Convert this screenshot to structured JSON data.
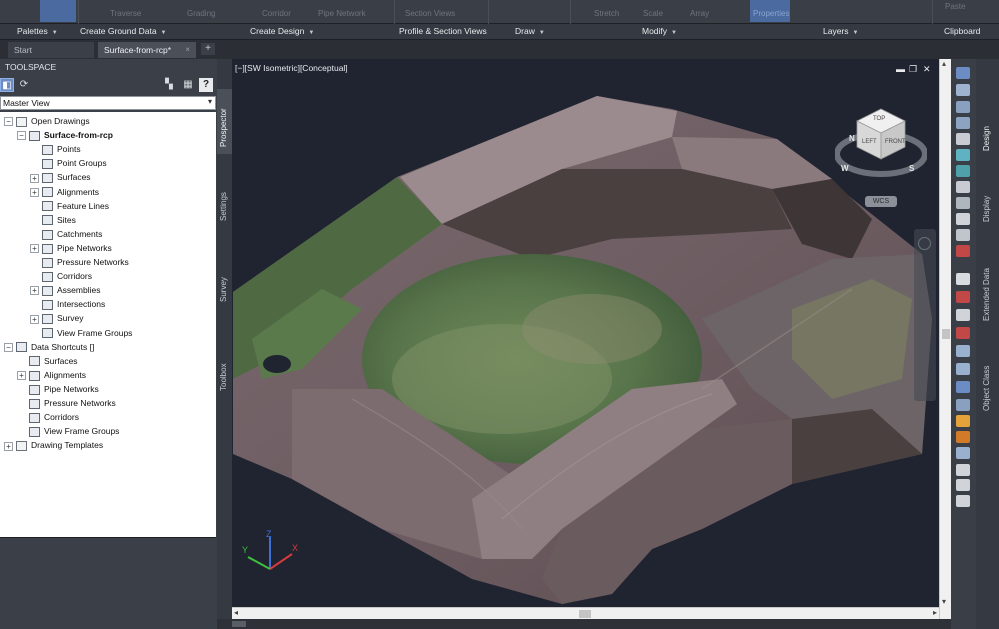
{
  "ribbon": {
    "tools_faded": [
      "Traverse",
      "Grading",
      "Corridor",
      "Pipe Network",
      "Section Views",
      "Stretch",
      "Scale",
      "Array",
      "Properties",
      "Paste"
    ],
    "panels": [
      {
        "label": "Palettes"
      },
      {
        "label": "Create Ground Data"
      },
      {
        "label": "Create Design"
      },
      {
        "label": "Profile & Section Views"
      },
      {
        "label": "Draw"
      },
      {
        "label": "Modify"
      },
      {
        "label": "Layers"
      },
      {
        "label": "Clipboard"
      }
    ]
  },
  "tabs": {
    "start": "Start",
    "active": "Surface-from-rcp*",
    "close": "×",
    "new": "+"
  },
  "toolspace": {
    "title": "TOOLSPACE",
    "view": "Master View",
    "tree": [
      {
        "label": "Open Drawings",
        "level": 0,
        "expander": "−",
        "icon": "folder"
      },
      {
        "label": "Surface-from-rcp",
        "level": 1,
        "expander": "−",
        "icon": "drawing",
        "bold": true
      },
      {
        "label": "Points",
        "level": 2,
        "expander": "",
        "icon": "point"
      },
      {
        "label": "Point Groups",
        "level": 2,
        "expander": "",
        "icon": "point-group"
      },
      {
        "label": "Surfaces",
        "level": 2,
        "expander": "+",
        "icon": "surface"
      },
      {
        "label": "Alignments",
        "level": 2,
        "expander": "+",
        "icon": "alignment"
      },
      {
        "label": "Feature Lines",
        "level": 2,
        "expander": "",
        "icon": "feature-line"
      },
      {
        "label": "Sites",
        "level": 2,
        "expander": "",
        "icon": "site"
      },
      {
        "label": "Catchments",
        "level": 2,
        "expander": "",
        "icon": "catchment"
      },
      {
        "label": "Pipe Networks",
        "level": 2,
        "expander": "+",
        "icon": "pipe"
      },
      {
        "label": "Pressure Networks",
        "level": 2,
        "expander": "",
        "icon": "pressure"
      },
      {
        "label": "Corridors",
        "level": 2,
        "expander": "",
        "icon": "corridor"
      },
      {
        "label": "Assemblies",
        "level": 2,
        "expander": "+",
        "icon": "assembly"
      },
      {
        "label": "Intersections",
        "level": 2,
        "expander": "",
        "icon": "intersection"
      },
      {
        "label": "Survey",
        "level": 2,
        "expander": "+",
        "icon": "survey"
      },
      {
        "label": "View Frame Groups",
        "level": 2,
        "expander": "",
        "icon": "view-frame"
      },
      {
        "label": "Data Shortcuts []",
        "level": 0,
        "expander": "−",
        "icon": "shortcut"
      },
      {
        "label": "Surfaces",
        "level": 1,
        "expander": "",
        "icon": "surface"
      },
      {
        "label": "Alignments",
        "level": 1,
        "expander": "+",
        "icon": "alignment"
      },
      {
        "label": "Pipe Networks",
        "level": 1,
        "expander": "",
        "icon": "pipe"
      },
      {
        "label": "Pressure Networks",
        "level": 1,
        "expander": "",
        "icon": "pressure"
      },
      {
        "label": "Corridors",
        "level": 1,
        "expander": "",
        "icon": "corridor"
      },
      {
        "label": "View Frame Groups",
        "level": 1,
        "expander": "",
        "icon": "view-frame"
      },
      {
        "label": "Drawing Templates",
        "level": 0,
        "expander": "+",
        "icon": "folder"
      }
    ],
    "left_tabs": [
      "Prospector",
      "Settings",
      "Survey",
      "Toolbox"
    ]
  },
  "viewport": {
    "label": "[−][SW Isometric][Conceptual]",
    "viewcube": {
      "top": "TOP",
      "left": "LEFT",
      "front": "FRONT",
      "compass": [
        "N",
        "W",
        "S"
      ],
      "wcs": "WCS"
    },
    "ucs": {
      "x": "X",
      "y": "Y",
      "z": "Z"
    }
  },
  "right_tabs": [
    "Design",
    "Display",
    "Extended Data",
    "Object Class"
  ],
  "colors": {
    "ribbon_bg": "#3a3f47",
    "viewport_bg": "#1f2430",
    "accent": "#6c8cc4"
  }
}
